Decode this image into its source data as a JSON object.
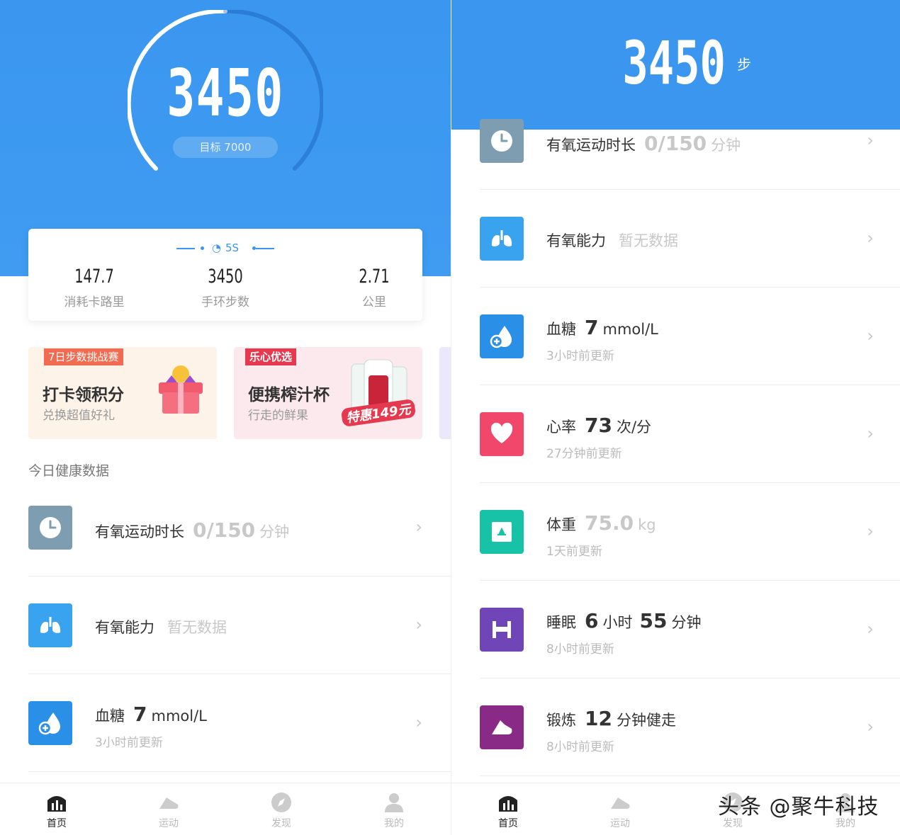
{
  "left": {
    "hero": {
      "steps": "3450",
      "goal": "目标 7000"
    },
    "stats": {
      "device": "5S",
      "items": [
        {
          "value": "147.7",
          "label": "消耗卡路里"
        },
        {
          "value": "3450",
          "label": "手环步数"
        },
        {
          "value": "2.71",
          "label": "公里"
        }
      ]
    },
    "promos": [
      {
        "tag": "7日步数挑战赛",
        "title": "打卡领积分",
        "subtitle": "兑换超值好礼"
      },
      {
        "tag": "乐心优选",
        "title": "便携榨汁杯",
        "subtitle": "行走的鲜果",
        "price": "特惠149元"
      }
    ],
    "section_title": "今日健康数据",
    "rows": [
      {
        "name": "有氧运动时长",
        "value": "0/150",
        "unit": "分钟",
        "icon": "clock-icon",
        "color": "#7f9db0"
      },
      {
        "name": "有氧能力",
        "nodata": "暂无数据",
        "icon": "lungs-icon",
        "color": "#3aa3f0"
      },
      {
        "name": "血糖",
        "value": "7",
        "unit": "mmol/L",
        "sub": "3小时前更新",
        "icon": "blood-drop-icon",
        "color": "#2a8fe6"
      }
    ]
  },
  "right": {
    "header": {
      "steps": "3450",
      "unit": "步"
    },
    "rows": [
      {
        "name": "有氧运动时长",
        "value": "0/150",
        "unit": "分钟",
        "icon": "clock-icon",
        "color": "#7f9db0"
      },
      {
        "name": "有氧能力",
        "nodata": "暂无数据",
        "icon": "lungs-icon",
        "color": "#3aa3f0"
      },
      {
        "name": "血糖",
        "value": "7",
        "unit": "mmol/L",
        "sub": "3小时前更新",
        "icon": "blood-drop-icon",
        "color": "#2a8fe6"
      },
      {
        "name": "心率",
        "value": "73",
        "unit": "次/分",
        "sub": "27分钟前更新",
        "icon": "heart-icon",
        "color": "#f0476a"
      },
      {
        "name": "体重",
        "value": "75.0",
        "unit": "kg",
        "sub": "1天前更新",
        "icon": "scale-icon",
        "color": "#18c2a7"
      },
      {
        "name": "睡眠",
        "value": "6",
        "unit": "小时",
        "value2": "55",
        "unit2": "分钟",
        "sub": "8小时前更新",
        "icon": "bed-icon",
        "color": "#7045b8"
      },
      {
        "name": "锻炼",
        "value": "12",
        "unit": "分钟健走",
        "sub": "8小时前更新",
        "icon": "shoe-icon",
        "color": "#8a2a87"
      }
    ]
  },
  "nav": [
    {
      "label": "首页",
      "icon": "home-chart-icon"
    },
    {
      "label": "运动",
      "icon": "shoe-icon"
    },
    {
      "label": "发现",
      "icon": "compass-icon"
    },
    {
      "label": "我的",
      "icon": "person-icon"
    }
  ],
  "watermark": "头条 @聚牛科技",
  "colors": {
    "primary": "#3a96ef",
    "chevron": "#c7c7c7"
  }
}
